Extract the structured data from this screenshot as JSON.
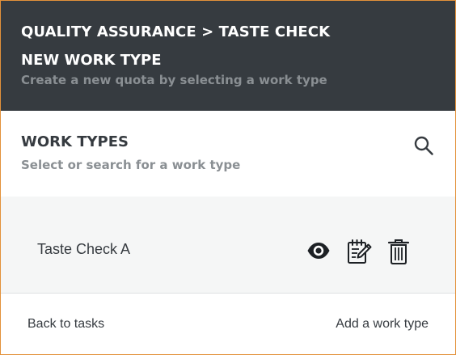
{
  "header": {
    "breadcrumb": "QUALITY ASSURANCE > TASTE CHECK",
    "title": "NEW WORK TYPE",
    "subtitle": "Create a new quota by selecting a work type"
  },
  "work_types": {
    "title": "WORK TYPES",
    "subtitle": "Select or search for a work type",
    "search_icon": "search-icon",
    "items": [
      {
        "label": "Taste Check A",
        "actions": [
          "eye-icon",
          "edit-notepad-icon",
          "trash-icon"
        ]
      }
    ]
  },
  "footer": {
    "back_label": "Back to tasks",
    "add_label": "Add a work type"
  },
  "colors": {
    "header_bg": "#363b40",
    "header_text": "#ffffff",
    "muted_text": "#8a8f93",
    "list_bg": "#f5f6f6",
    "frame_border": "#e3913a"
  }
}
